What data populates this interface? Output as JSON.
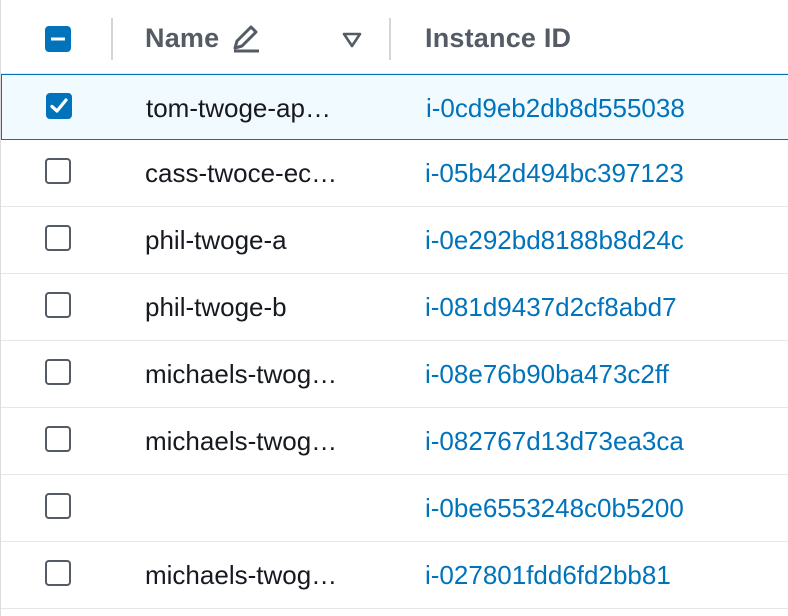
{
  "header": {
    "name_label": "Name",
    "instance_id_label": "Instance ID",
    "select_all_state": "indeterminate"
  },
  "rows": [
    {
      "name": "tom-twoge-ap…",
      "instance_id": "i-0cd9eb2db8d555038",
      "checked": true
    },
    {
      "name": "cass-twoce-ec…",
      "instance_id": "i-05b42d494bc397123",
      "checked": false
    },
    {
      "name": "phil-twoge-a",
      "instance_id": "i-0e292bd8188b8d24c",
      "checked": false
    },
    {
      "name": "phil-twoge-b",
      "instance_id": "i-081d9437d2cf8abd7",
      "checked": false
    },
    {
      "name": "michaels-twog…",
      "instance_id": "i-08e76b90ba473c2ff",
      "checked": false
    },
    {
      "name": "michaels-twog…",
      "instance_id": "i-082767d13d73ea3ca",
      "checked": false
    },
    {
      "name": "",
      "instance_id": "i-0be6553248c0b5200",
      "checked": false
    },
    {
      "name": "michaels-twog…",
      "instance_id": "i-027801fdd6fd2bb81",
      "checked": false
    }
  ],
  "colors": {
    "accent": "#0073bb",
    "selected_row_bg": "#f1faff",
    "header_text": "#545b64"
  },
  "icons": {
    "edit": "pencil-icon",
    "sort": "sort-down-triangle-icon"
  }
}
